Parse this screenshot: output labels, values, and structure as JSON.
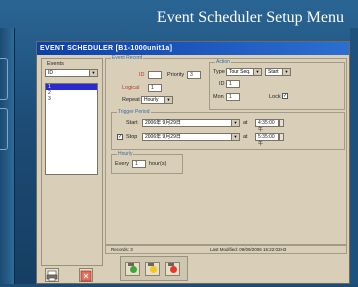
{
  "banner": {
    "title": "Event Scheduler Setup Menu"
  },
  "window": {
    "title": "EVENT SCHEDULER [B1-1000unit1a]"
  },
  "events": {
    "label": "Events",
    "filter": "ID",
    "items": [
      "1",
      "2",
      "3"
    ]
  },
  "event_record": {
    "label": "Event Record",
    "id_label": "ID",
    "id_value": "",
    "priority_label": "Priority",
    "priority_value": "3",
    "logical_label": "Logical",
    "logical_value": "1",
    "repeat_label": "Repeat",
    "repeat_value": "Hourly"
  },
  "action": {
    "label": "Action",
    "type_label": "Type",
    "type_value": "Tour Seq.",
    "command_value": "Start",
    "id_label": "ID",
    "id_value": "1",
    "mon_label": "Mon",
    "mon_value": "1",
    "lock_label": "Lock",
    "lock_checked": true
  },
  "trigger_period": {
    "label": "Trigger Period",
    "start_label": "Start",
    "start_date": "2006年 9月29日",
    "start_time": "4:35:00 午",
    "stop_label": "Stop",
    "stop_checked": true,
    "stop_date": "2006年 9月29日",
    "stop_time": "5:35:00 午",
    "separator": "at"
  },
  "hourly": {
    "label": "Hourly",
    "every_label": "Every",
    "every_value": "1",
    "unit_label": "hour(s)"
  },
  "status": {
    "records": "Records:  3",
    "modified": "Last Modified:  09/09/2006 16:22:02H3"
  },
  "colors": {
    "lamp_green": "#3fa63a",
    "lamp_yellow": "#f0c81e",
    "lamp_red": "#e23b2a"
  }
}
